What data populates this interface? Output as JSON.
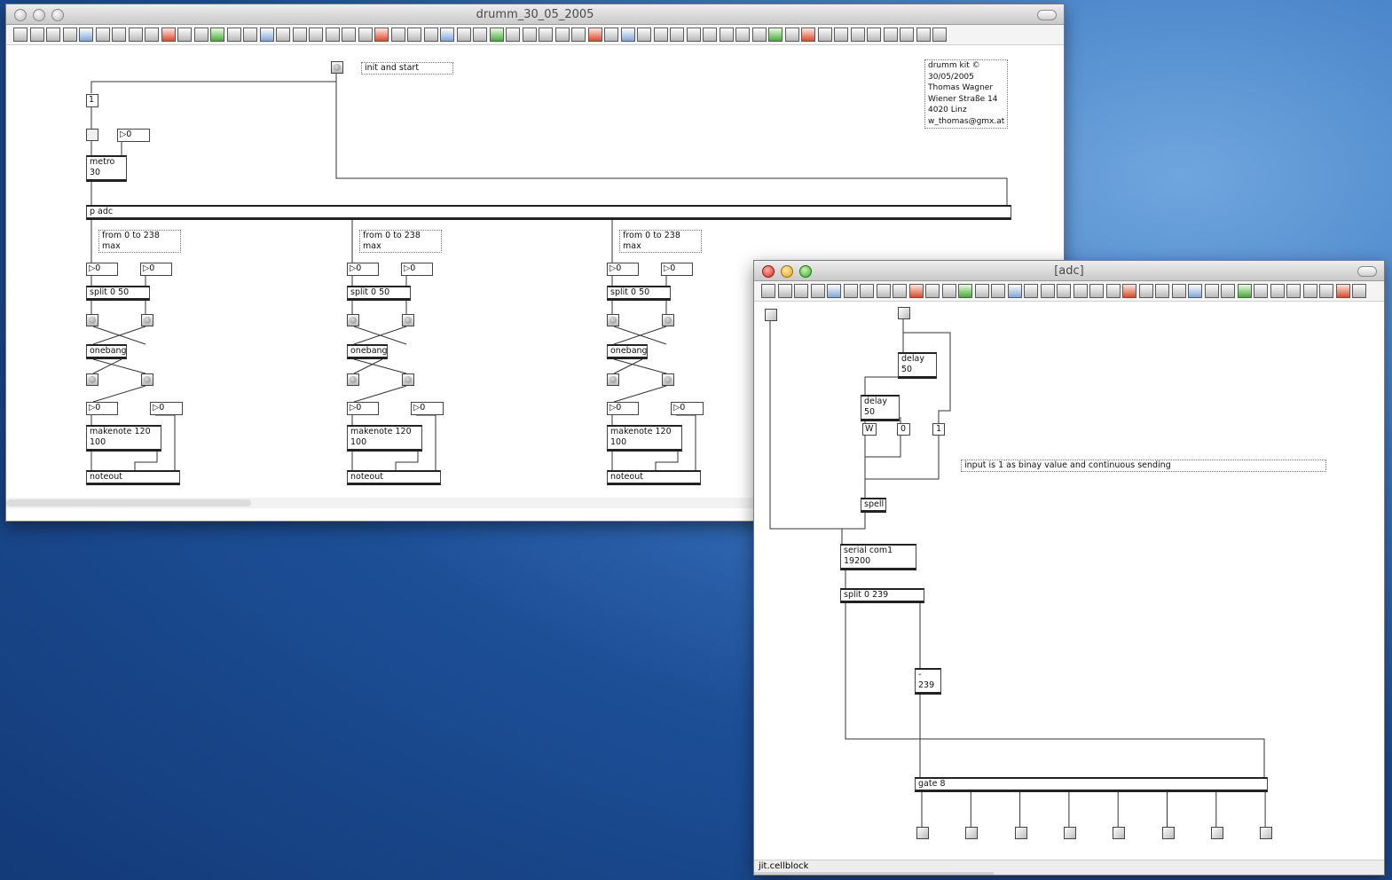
{
  "window1": {
    "title": "drumm_30_05_2005",
    "comments": {
      "init": "init and start",
      "credits": "drumm kit ©\n30/05/2005\nThomas Wagner\nWiener Straße 14\n4020 Linz\nw_thomas@gmx.at",
      "range1": "from 0 to 238\nmax",
      "range2": "from 0 to 238\nmax",
      "range3": "from 0 to 238\nmax"
    },
    "objects": {
      "msg_one": "1",
      "num_zero": "▷0",
      "metro": "metro\n30",
      "padc": "p adc",
      "split": "split 0 50",
      "onebang": "onebang",
      "makenote": "makenote 120\n100",
      "noteout": "noteout",
      "num_in": "▷0"
    }
  },
  "window2": {
    "title": "[adc]",
    "status": "jit.cellblock",
    "comment": "input is 1 as binay value and continuous sending",
    "objects": {
      "delay1": "delay\n50",
      "delay2": "delay\n50",
      "msg_w": "W",
      "msg_0": "0",
      "msg_1": "1",
      "spell": "spell",
      "serial": "serial com1\n19200",
      "split": "split 0 239",
      "minus": "-\n239",
      "gate": "gate 8"
    }
  },
  "icons": [
    "patcher-toolbar-icon",
    "bang-icon",
    "toggle-icon",
    "number-icon",
    "message-icon",
    "comment-icon",
    "slider-icon",
    "dial-icon",
    "lcd-icon",
    "fps-icon",
    "js-icon",
    "hint-icon"
  ]
}
